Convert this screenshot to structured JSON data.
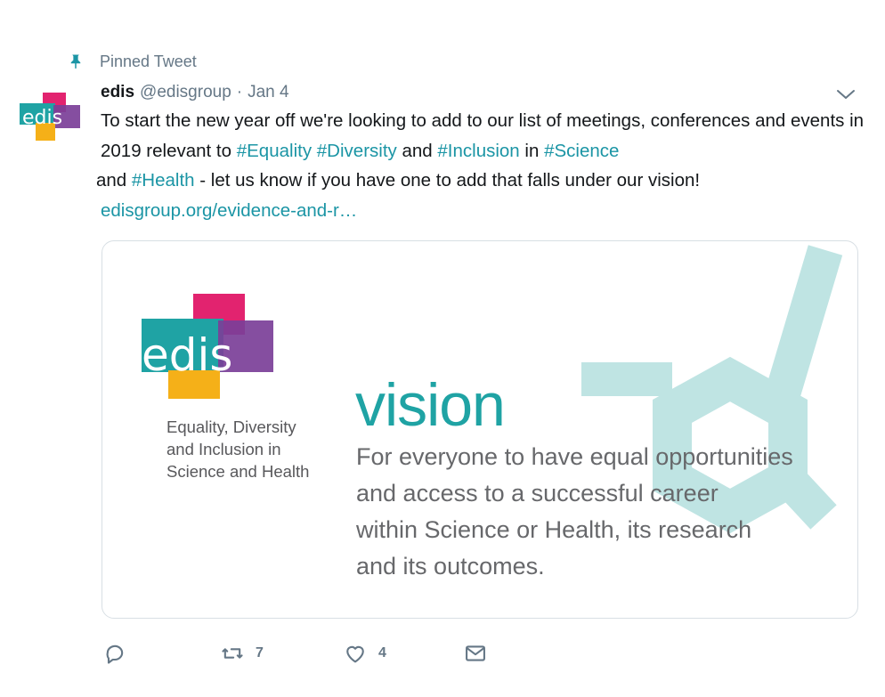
{
  "pinned": {
    "label": "Pinned Tweet",
    "icon": "pin-icon"
  },
  "tweet": {
    "display_name": "edis",
    "handle": "@edisgroup",
    "separator": "·",
    "date": "Jan 4",
    "avatar_text": "edis",
    "text": {
      "part1": "To start the new year off we're looking to add to our list of meetings, conferences and events in 2019 relevant to ",
      "tag_equality": "#Equality",
      "tag_diversity": "#Diversity",
      "and1": " and ",
      "tag_inclusion": "#Inclusion",
      "in1": " in ",
      "tag_science": "#Science",
      "and2": " and ",
      "tag_health": "#Health",
      "part2": " - let us know if you have one to add that falls under our vision!",
      "link": "edisgroup.org/evidence-and-r…"
    }
  },
  "card": {
    "logo_text": "edis",
    "tagline": [
      "Equality, Diversity",
      "and Inclusion in",
      "Science and Health"
    ],
    "title": "vision",
    "body": [
      "For everyone to have equal opportunities",
      "and access to a successful career",
      "within Science or Health, its research",
      "and its outcomes."
    ]
  },
  "actions": {
    "reply": {
      "icon": "reply-icon",
      "count": ""
    },
    "retweet": {
      "icon": "retweet-icon",
      "count": "7"
    },
    "like": {
      "icon": "heart-icon",
      "count": "4"
    },
    "dm": {
      "icon": "envelope-icon"
    }
  },
  "colors": {
    "accent": "#1b95a5",
    "teal": "#1fa3a4",
    "pink": "#e2236f",
    "purple": "#7b3f98",
    "orange": "#f5b018",
    "hex": "#bfe4e3",
    "muted": "#657786"
  }
}
